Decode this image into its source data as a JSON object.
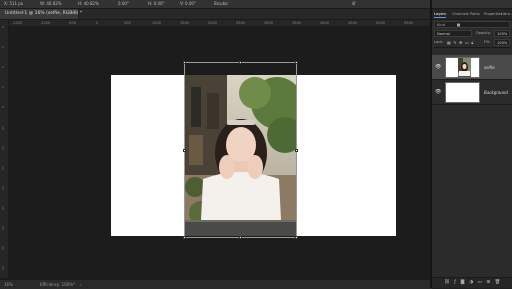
{
  "options_bar": {
    "fields": [
      "X: 511 px",
      "W: 40.82%",
      "H: 40.82%",
      "0.00°",
      "H: 0.00°",
      "V: 0.00°",
      "Bicubic"
    ],
    "icons": [
      "warp-icon",
      "cancel-transform-icon",
      "commit-check-icon"
    ]
  },
  "document": {
    "tab_title": "Untitled-1 @ 16% (selfie, RGB/8) *",
    "close_glyph": "×"
  },
  "ruler": {
    "top_ticks": [
      "-1500",
      "-1000",
      "-500",
      "0",
      "500",
      "1000",
      "1500",
      "2000",
      "2500",
      "3000",
      "3500",
      "4000",
      "4500",
      "5000",
      "5500"
    ],
    "left_ticks": [
      "0",
      "2",
      "4",
      "6",
      "8",
      "10",
      "12",
      "14",
      "16",
      "18",
      "20",
      "22",
      "24"
    ]
  },
  "status_bar": {
    "zoom": "16%",
    "info": "Efficiency: 100%*",
    "arrow": "›"
  },
  "panels": {
    "tabs": [
      "Layers",
      "Channels",
      "Paths",
      "Properties",
      "Libra..."
    ],
    "active_tab": "Layers",
    "kind_filter": "Kind",
    "filter_icons": [
      "image-filter-icon",
      "adjustment-filter-icon",
      "type-filter-icon",
      "shape-filter-icon",
      "smart-filter-icon"
    ],
    "blend_mode": "Normal",
    "opacity_label": "Opacity:",
    "opacity_value": "100%",
    "lock_label": "Lock:",
    "fill_label": "Fill:",
    "fill_value": "100%",
    "footer_icons": [
      "link-icon",
      "fx-icon",
      "mask-icon",
      "adjustment-icon",
      "group-icon",
      "new-layer-icon",
      "trash-icon"
    ]
  },
  "layers": [
    {
      "name": "selfie",
      "selected": true,
      "visible": true
    },
    {
      "name": "Background",
      "selected": false,
      "visible": true
    }
  ],
  "colors": {
    "accent": "#5a9bd8",
    "canvas_bg": "#1c1c1c",
    "panel_bg": "#2b2b2b"
  }
}
